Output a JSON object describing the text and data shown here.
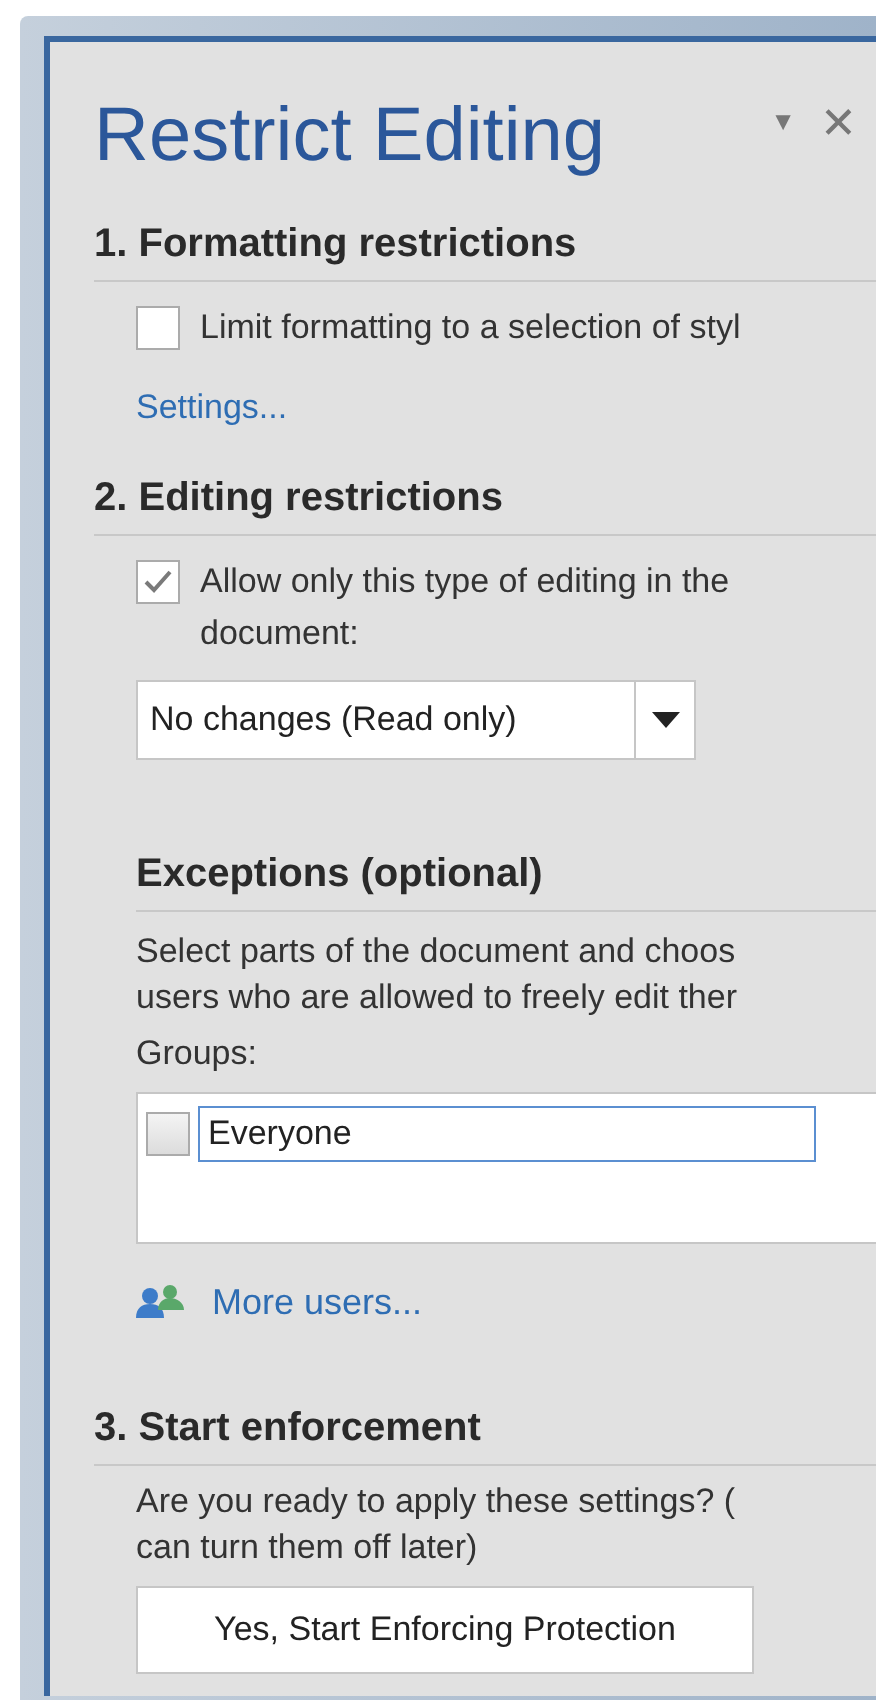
{
  "pane": {
    "title": "Restrict Editing",
    "menu_glyph": "▼",
    "close_glyph": "✕"
  },
  "formatting": {
    "heading": "1. Formatting restrictions",
    "checkbox": {
      "label": "Limit formatting to a selection of styl",
      "checked": false
    },
    "link": "Settings..."
  },
  "editing": {
    "heading": "2. Editing restrictions",
    "checkbox": {
      "label": "Allow only this type of editing in the document:",
      "checked": true
    },
    "dropdown": {
      "value": "No changes (Read only)"
    }
  },
  "exceptions": {
    "heading": "Exceptions (optional)",
    "description": [
      "Select parts of the document and choos",
      "users who are allowed to freely edit ther"
    ],
    "groups_label": "Groups:",
    "groups": [
      {
        "name": "Everyone",
        "checked": false
      }
    ],
    "link": "More users..."
  },
  "enforcement": {
    "heading": "3. Start enforcement",
    "description": [
      "Are you ready to apply these settings? (",
      "can turn them off later)"
    ],
    "button": "Yes, Start Enforcing Protection"
  }
}
